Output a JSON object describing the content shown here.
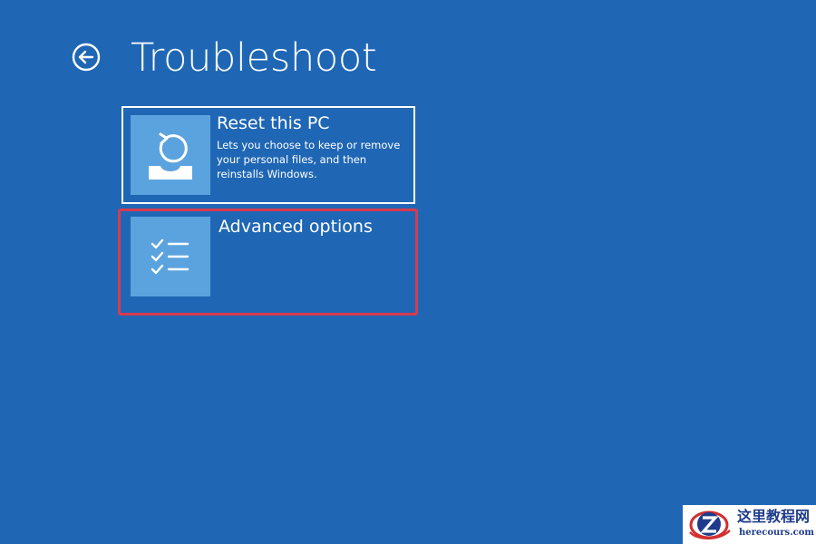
{
  "colors": {
    "background": "#1f67b5",
    "tile_icon_background": "#5ba3de",
    "selection_highlight": "#d83a4f",
    "text": "#ffffff"
  },
  "header": {
    "title": "Troubleshoot",
    "back_icon": "back-arrow-circle-icon"
  },
  "options": [
    {
      "title": "Reset this PC",
      "description": "Lets you choose to keep or remove your personal files, and then reinstalls Windows.",
      "icon": "reset-pc-icon"
    },
    {
      "title": "Advanced options",
      "description": "",
      "icon": "checklist-icon",
      "highlighted": true
    }
  ],
  "watermark": {
    "title": "这里教程网",
    "url": "herecours.com",
    "icon": "z-logo-icon"
  }
}
